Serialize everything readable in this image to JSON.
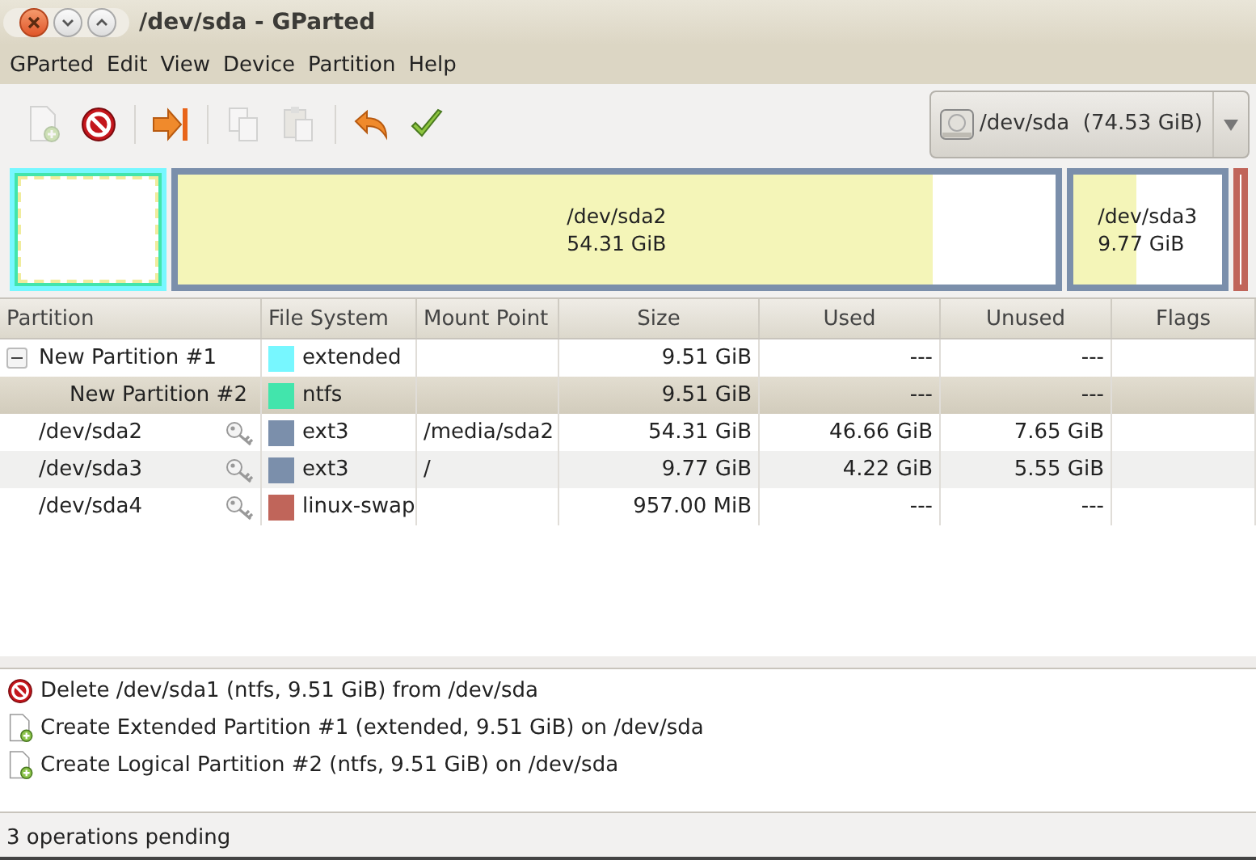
{
  "window": {
    "title": "/dev/sda - GParted"
  },
  "menu": [
    "GParted",
    "Edit",
    "View",
    "Device",
    "Partition",
    "Help"
  ],
  "toolbar": [
    {
      "kind": "new",
      "disabled": true
    },
    {
      "kind": "delete",
      "disabled": false
    },
    {
      "kind": "resize",
      "disabled": false
    },
    {
      "kind": "copy",
      "disabled": true
    },
    {
      "kind": "paste",
      "disabled": true
    },
    {
      "kind": "undo",
      "disabled": false
    },
    {
      "kind": "apply",
      "disabled": false
    }
  ],
  "device": {
    "name": "/dev/sda",
    "size": "(74.53 GiB)"
  },
  "disk_map": [
    {
      "kind": "extended",
      "selected": true
    },
    {
      "kind": "primary",
      "label": "/dev/sda2",
      "size": "54.31 GiB",
      "level": 0.86,
      "color": "#7b8fab"
    },
    {
      "kind": "primary",
      "label": "/dev/sda3",
      "size": "9.77 GiB",
      "level": 0.43,
      "color": "#7b8fab"
    },
    {
      "kind": "primary",
      "color": "#c0655a"
    }
  ],
  "table": {
    "columns": [
      "Partition",
      "File System",
      "Mount Point",
      "Size",
      "Used",
      "Unused",
      "Flags"
    ],
    "rows": [
      {
        "partition": "New Partition #1",
        "fs": "extended",
        "color": "#77f7ff",
        "size": "9.51 GiB",
        "used": "---",
        "unused": "---",
        "locked": false,
        "selected": false,
        "expanded": true,
        "children": [
          {
            "partition": "New Partition #2",
            "fs": "ntfs",
            "color": "#42e5ac",
            "size": "9.51 GiB",
            "used": "---",
            "unused": "---",
            "locked": false,
            "selected": true
          }
        ]
      },
      {
        "partition": "/dev/sda2",
        "fs": "ext3",
        "color": "#7b8fab",
        "mount": "/media/sda2",
        "size": "54.31 GiB",
        "used": "46.66 GiB",
        "unused": "7.65 GiB",
        "locked": true,
        "selected": false
      },
      {
        "partition": "/dev/sda3",
        "fs": "ext3",
        "color": "#7b8fab",
        "mount": "/",
        "size": "9.77 GiB",
        "used": "4.22 GiB",
        "unused": "5.55 GiB",
        "locked": true,
        "selected": false
      },
      {
        "partition": "/dev/sda4",
        "fs": "linux-swap",
        "color": "#c0655a",
        "size": "957.00 MiB",
        "used": "---",
        "unused": "---",
        "locked": true,
        "selected": false
      }
    ]
  },
  "operations": [
    {
      "kind": "delete",
      "text": "Delete /dev/sda1 (ntfs, 9.51 GiB) from /dev/sda"
    },
    {
      "kind": "create",
      "text": "Create Extended Partition #1 (extended, 9.51 GiB) on /dev/sda"
    },
    {
      "kind": "create",
      "text": "Create Logical Partition #2 (ntfs, 9.51 GiB) on /dev/sda"
    }
  ],
  "status_bar": "3 operations pending"
}
